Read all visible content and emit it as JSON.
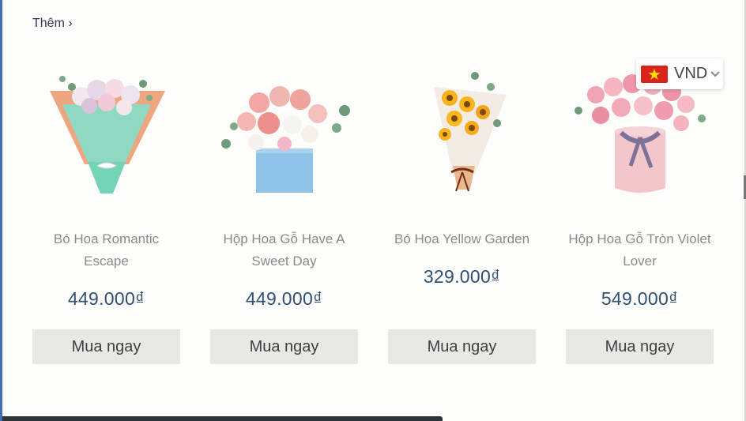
{
  "header": {
    "more_link": "Thêm ›"
  },
  "products": [
    {
      "name": "Bó Hoa Romantic Escape",
      "price": "449.000₫",
      "button": "Mua ngay"
    },
    {
      "name": "Hộp Hoa Gỗ Have A Sweet Day",
      "price": "449.000₫",
      "button": "Mua ngay"
    },
    {
      "name": "Bó Hoa Yellow Garden",
      "price": "329.000₫",
      "button": "Mua ngay"
    },
    {
      "name": "Hộp Hoa Gỗ Tròn Violet Lover",
      "price": "549.000₫",
      "button": "Mua ngay"
    }
  ],
  "currency": {
    "code": "VND",
    "flag_icon": "vietnam-flag-icon"
  },
  "colors": {
    "price": "#2f4f73",
    "button_bg": "#e8e8e6",
    "name": "#8a8a8a",
    "link": "#3b3060"
  }
}
